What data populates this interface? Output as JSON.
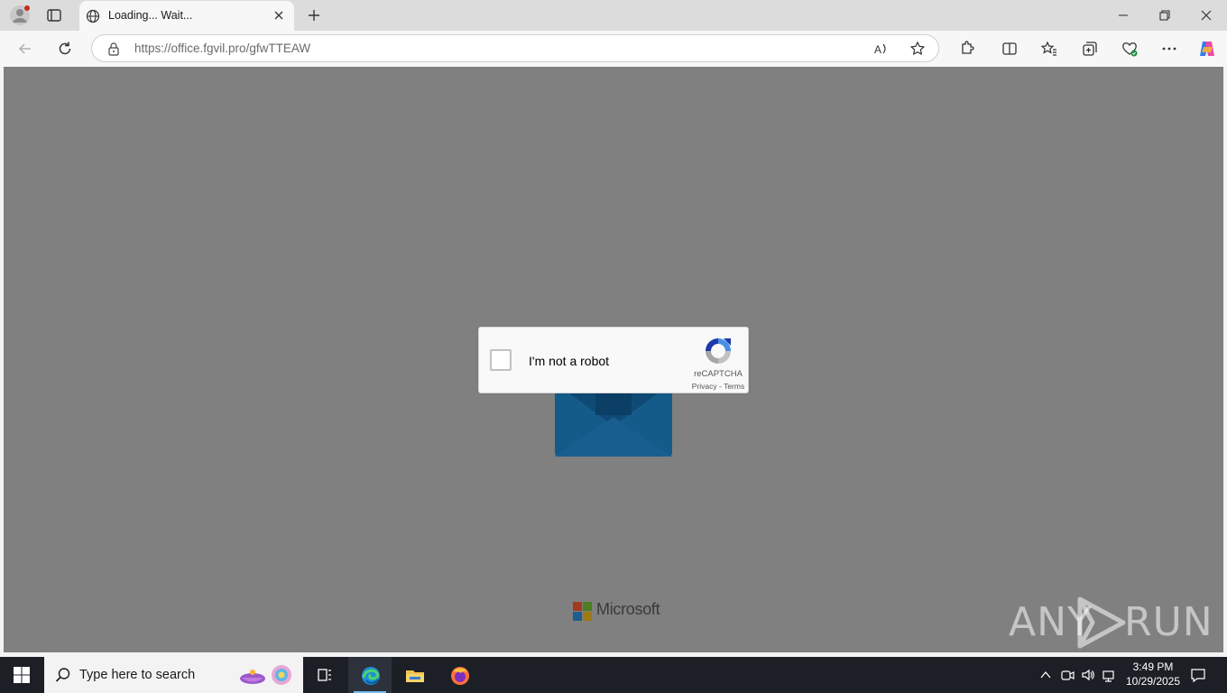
{
  "browser": {
    "tab": {
      "title": "Loading... Wait...",
      "favicon": "globe-icon"
    },
    "address_bar": {
      "url_host": "https://office.fgvil.pro",
      "url_path": "/gfwTTEAW",
      "security_icon": "lock-icon"
    },
    "toolbar_icons": [
      "read-aloud-icon",
      "favorite-star-icon",
      "extensions-icon",
      "split-screen-icon",
      "favorites-icon",
      "collections-icon",
      "browser-essentials-icon",
      "more-icon",
      "copilot-icon"
    ],
    "window_controls": [
      "minimize-icon",
      "restore-icon",
      "close-icon"
    ]
  },
  "page": {
    "background_color": "#808080",
    "recaptcha": {
      "checkbox_label": "I'm not a robot",
      "brand": "reCAPTCHA",
      "privacy_link": "Privacy",
      "separator": " - ",
      "terms_link": "Terms"
    },
    "footer": {
      "brand_text": "Microsoft"
    },
    "watermark": {
      "left": "ANY",
      "right": "RUN"
    }
  },
  "taskbar": {
    "search_placeholder": "Type here to search",
    "pinned_apps": [
      "task-view-icon",
      "edge-icon",
      "file-explorer-icon",
      "firefox-icon"
    ],
    "active_app": "edge-icon",
    "clock": {
      "time": "3:49 PM",
      "date": "10/29/2025"
    }
  }
}
